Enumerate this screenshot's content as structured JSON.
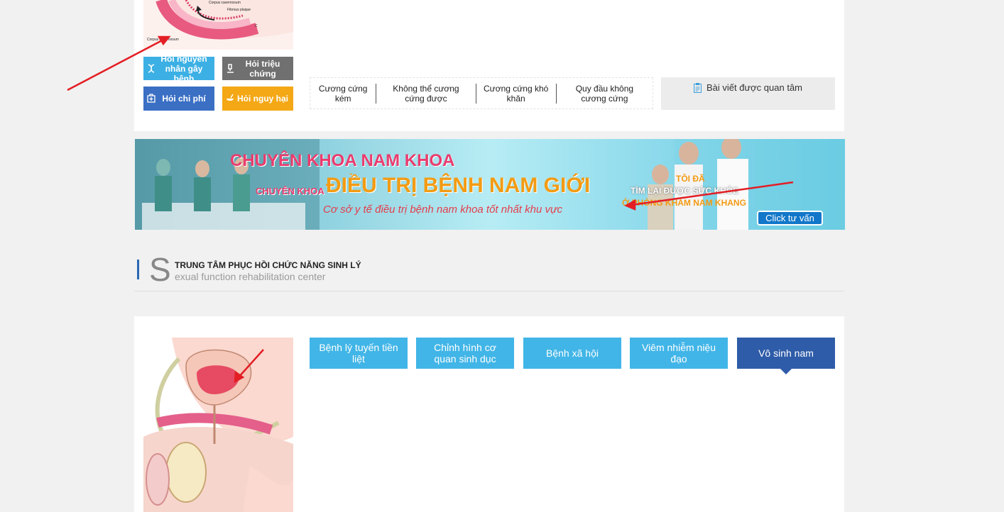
{
  "top": {
    "anatomy_labels": [
      "Corpus cavernosum",
      "Fibrous plaque",
      "C",
      "Corpus cavernosum"
    ],
    "quick_buttons": {
      "cause": "Hỏi nguyên nhân gây bệnh",
      "symptom": "Hỏi triệu chứng",
      "cost": "Hỏi chi phí",
      "harm": "Hỏi nguy hại"
    },
    "tabs": [
      "Cương cứng kém",
      "Không thể cương cứng được",
      "Cương cứng khó khăn",
      "Quy đầu không cương cứng"
    ],
    "related": "Bài viết được quan tâm"
  },
  "banner": {
    "title1": "CHUYÊN KHOA NAM KHOA",
    "title2_small": "CHUYÊN KHOA",
    "title2_big": "ĐIỀU TRỊ BỆNH NAM GIỚI",
    "subtitle": "Cơ sở y tế điều trị bệnh nam khoa tốt nhất khu vực",
    "right_line1": "TÔI ĐÃ",
    "right_line2": "TÌM LẠI ĐƯỢC SỨC KHỎE",
    "right_line3": "Ở PHÒNG KHÁM NAM KHANG",
    "cta": "Click tư vấn"
  },
  "section": {
    "letter": "S",
    "title": "TRUNG TÂM PHỤC HỒI CHỨC NĂNG SINH LÝ",
    "subtitle": "exual function rehabilitation center"
  },
  "categories": [
    "Bệnh lý tuyến tiền liệt",
    "Chỉnh hình cơ quan sinh dục",
    "Bệnh xã hội",
    "Viêm nhiễm niệu đạo",
    "Vô sinh nam"
  ],
  "colors": {
    "blue": "#41b5e7",
    "active": "#2e5ca8",
    "arrow": "#e31e24"
  }
}
